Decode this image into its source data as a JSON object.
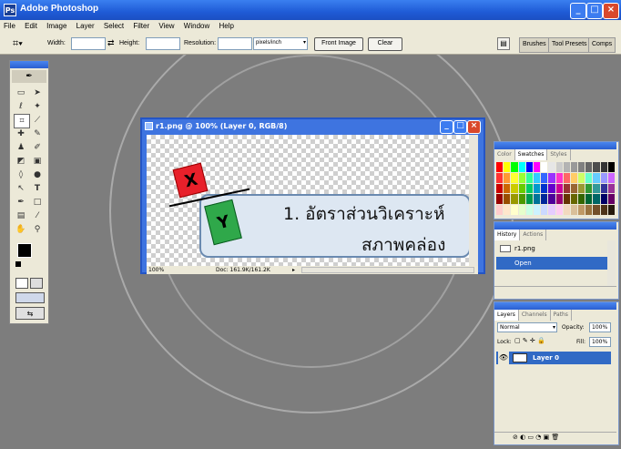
{
  "app": {
    "title": "Adobe Photoshop"
  },
  "menu": [
    "File",
    "Edit",
    "Image",
    "Layer",
    "Select",
    "Filter",
    "View",
    "Window",
    "Help"
  ],
  "options": {
    "width_label": "Width:",
    "height_label": "Height:",
    "resolution_label": "Resolution:",
    "units": "pixels/inch",
    "front_image": "Front Image",
    "clear": "Clear",
    "tabs": [
      "Brushes",
      "Tool Presets",
      "Comps"
    ]
  },
  "document": {
    "title": "r1.png @ 100% (Layer 0, RGB/8)",
    "zoom": "100%",
    "doc_size": "Doc: 161.9K/161.2K",
    "heading_line1": "1. อัตราส่วนวิเคราะห์",
    "heading_line2": "สภาพคล่อง",
    "box_x": "X",
    "box_y": "Y"
  },
  "swatches_panel": {
    "tabs": [
      "Color",
      "Swatches",
      "Styles"
    ],
    "colors": [
      "#ff0000",
      "#ffff00",
      "#00ff00",
      "#00ffff",
      "#0000ff",
      "#ff00ff",
      "#ffffff",
      "#e6e6e6",
      "#cccccc",
      "#b3b3b3",
      "#999999",
      "#808080",
      "#666666",
      "#4d4d4d",
      "#333333",
      "#000000",
      "#ff3333",
      "#ff9933",
      "#ffff33",
      "#99ff33",
      "#33ff99",
      "#33ccff",
      "#3366ff",
      "#9933ff",
      "#ff33cc",
      "#ff6666",
      "#ffcc66",
      "#ccff66",
      "#66ffcc",
      "#66ccff",
      "#9999ff",
      "#cc66ff",
      "#cc0000",
      "#cc6600",
      "#cccc00",
      "#66cc00",
      "#00cc66",
      "#0099cc",
      "#0033cc",
      "#6600cc",
      "#cc0099",
      "#993333",
      "#996633",
      "#999933",
      "#339933",
      "#339999",
      "#333399",
      "#993399",
      "#990000",
      "#994d00",
      "#999900",
      "#4d9900",
      "#00994d",
      "#007399",
      "#002699",
      "#4d0099",
      "#990073",
      "#663300",
      "#666600",
      "#336600",
      "#006633",
      "#006666",
      "#000066",
      "#660066",
      "#ffcccc",
      "#ffe6cc",
      "#ffffcc",
      "#e6ffcc",
      "#ccffe6",
      "#ccf2ff",
      "#ccd9ff",
      "#e6ccff",
      "#ffccf2",
      "#f2d9bf",
      "#d9bf99",
      "#bf9966",
      "#997340",
      "#73502b",
      "#4d3319",
      "#261a0d"
    ]
  },
  "history_panel": {
    "tabs": [
      "History",
      "Actions"
    ],
    "snapshot": "r1.png",
    "step": "Open"
  },
  "layers_panel": {
    "tabs": [
      "Layers",
      "Channels",
      "Paths"
    ],
    "blend_mode": "Normal",
    "opacity_label": "Opacity:",
    "opacity": "100%",
    "lock_label": "Lock:",
    "fill_label": "Fill:",
    "fill": "100%",
    "layer_name": "Layer 0"
  },
  "colors": {
    "titlebar": "#1f5bd6",
    "selection": "#316ac5",
    "box_x": "#e8202a",
    "box_y": "#2fa84a"
  }
}
